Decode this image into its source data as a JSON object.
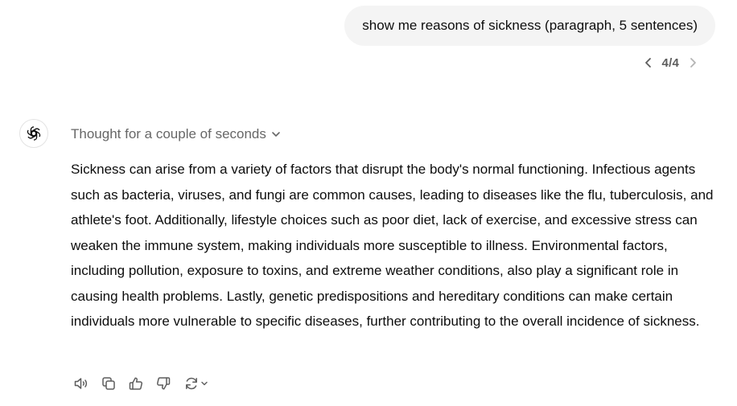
{
  "user_message": {
    "text": "show me reasons of sickness (paragraph, 5 sentences)"
  },
  "pager": {
    "text": "4/4",
    "prev_icon": "chevron-left-icon",
    "next_icon": "chevron-right-icon"
  },
  "assistant": {
    "avatar_icon": "chatgpt-logo-icon",
    "thought_label": "Thought for a couple of seconds",
    "answer": "Sickness can arise from a variety of factors that disrupt the body's normal functioning. Infectious agents such as bacteria, viruses, and fungi are common causes, leading to diseases like the flu, tuberculosis, and athlete's foot. Additionally, lifestyle choices such as poor diet, lack of exercise, and excessive stress can weaken the immune system, making individuals more susceptible to illness. Environmental factors, including pollution, exposure to toxins, and extreme weather conditions, also play a significant role in causing health problems. Lastly, genetic predispositions and hereditary conditions can make certain individuals more vulnerable to specific diseases, further contributing to the overall incidence of sickness."
  },
  "actions": [
    {
      "icon": "speaker-icon"
    },
    {
      "icon": "copy-icon"
    },
    {
      "icon": "thumbs-up-icon"
    },
    {
      "icon": "thumbs-down-icon"
    },
    {
      "icon": "regenerate-icon"
    }
  ],
  "colors": {
    "bubble": "#f4f4f4",
    "muted_text": "#676767",
    "icon": "#5d5d5d",
    "text": "#0d0d0d"
  }
}
